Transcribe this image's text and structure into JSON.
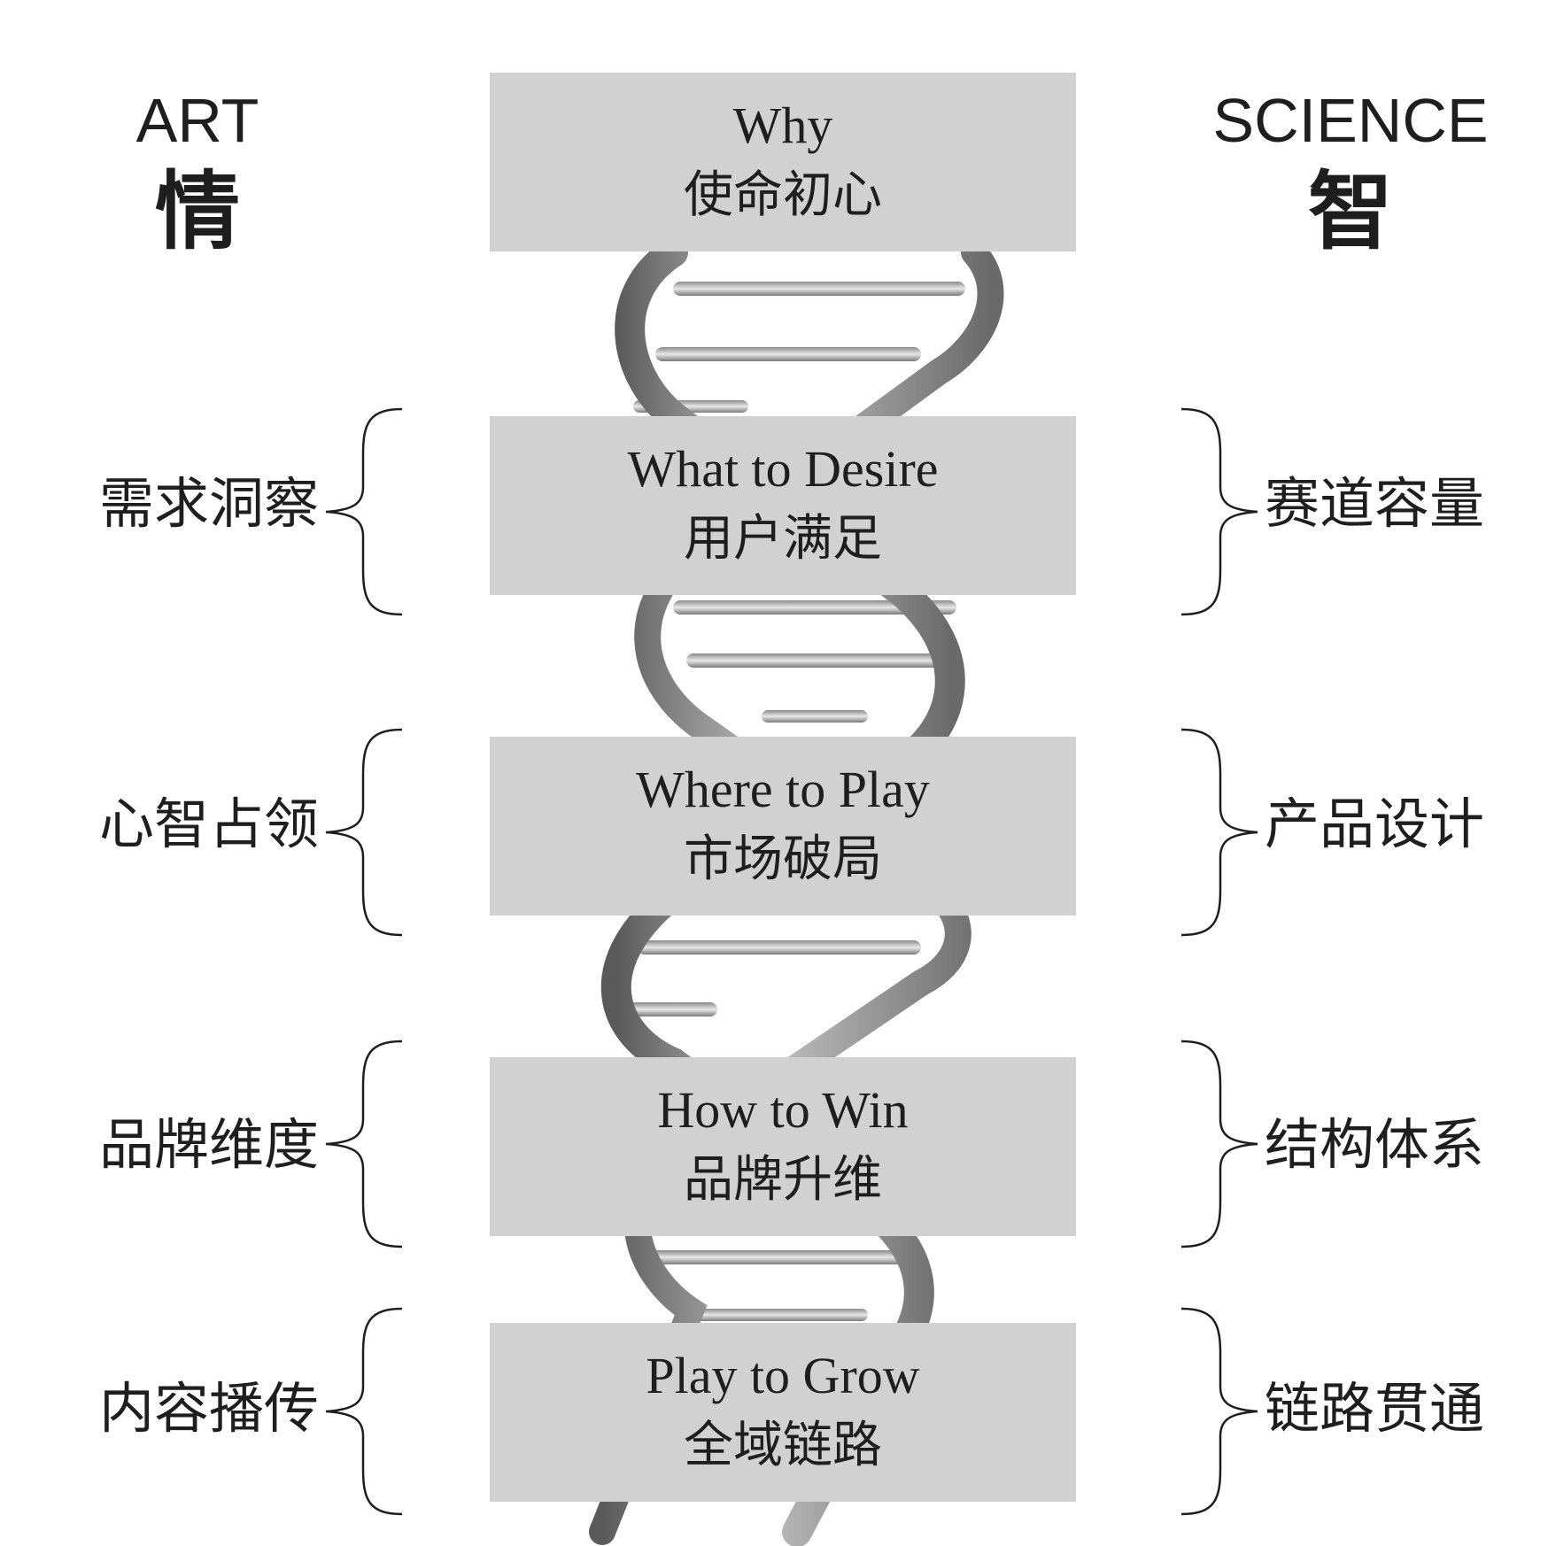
{
  "header": {
    "left": {
      "en": "ART",
      "zh": "情"
    },
    "right": {
      "en": "SCIENCE",
      "zh": "智"
    }
  },
  "rows": [
    {
      "en": "Why",
      "zh": "使命初心"
    },
    {
      "en": "What to Desire",
      "zh": "用户满足",
      "left": "需求洞察",
      "right": "赛道容量"
    },
    {
      "en": "Where to Play",
      "zh": "市场破局",
      "left": "心智占领",
      "right": "产品设计"
    },
    {
      "en": "How to Win",
      "zh": "品牌升维",
      "left": "品牌维度",
      "right": "结构体系"
    },
    {
      "en": "Play to Grow",
      "zh": "全域链路",
      "left": "内容播传",
      "right": "链路贯通"
    }
  ],
  "colors": {
    "box": "#d1d1d1",
    "text": "#1e1e1e",
    "helix_light": "#e6e6e6",
    "helix_dark": "#6e6e6e"
  }
}
